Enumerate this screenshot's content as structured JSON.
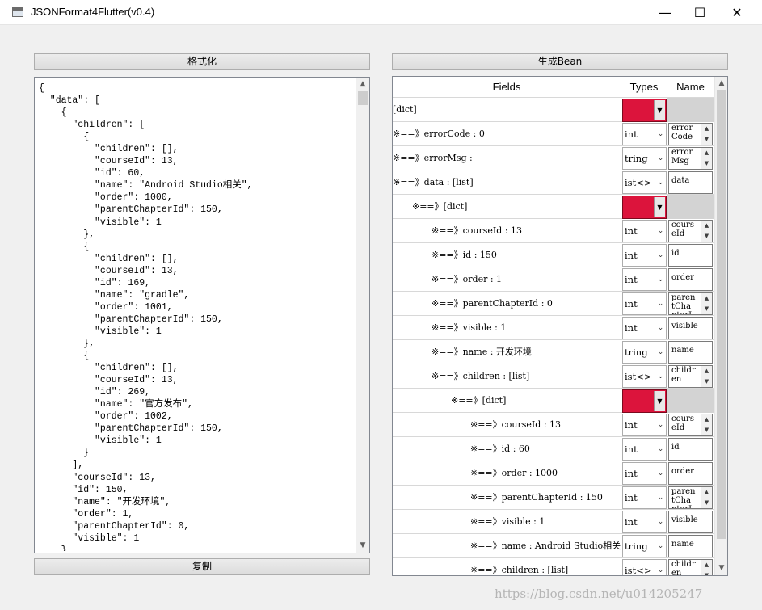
{
  "window": {
    "title": "JSONFormat4Flutter(v0.4)",
    "minimize_glyph": "—",
    "maximize_glyph": "☐",
    "close_glyph": "✕"
  },
  "left": {
    "format_button": "格式化",
    "copy_button": "复制",
    "json_text": "{\n  \"data\": [\n    {\n      \"children\": [\n        {\n          \"children\": [],\n          \"courseId\": 13,\n          \"id\": 60,\n          \"name\": \"Android Studio相关\",\n          \"order\": 1000,\n          \"parentChapterId\": 150,\n          \"visible\": 1\n        },\n        {\n          \"children\": [],\n          \"courseId\": 13,\n          \"id\": 169,\n          \"name\": \"gradle\",\n          \"order\": 1001,\n          \"parentChapterId\": 150,\n          \"visible\": 1\n        },\n        {\n          \"children\": [],\n          \"courseId\": 13,\n          \"id\": 269,\n          \"name\": \"官方发布\",\n          \"order\": 1002,\n          \"parentChapterId\": 150,\n          \"visible\": 1\n        }\n      ],\n      \"courseId\": 13,\n      \"id\": 150,\n      \"name\": \"开发环境\",\n      \"order\": 1,\n      \"parentChapterId\": 0,\n      \"visible\": 1\n    },"
  },
  "right": {
    "generate_button": "生成Bean",
    "headers": {
      "fields": "Fields",
      "types": "Types",
      "name": "Name"
    },
    "rows": [
      {
        "field": "[dict]",
        "type": "",
        "name": ""
      },
      {
        "field": "※==》errorCode : 0",
        "type": "int",
        "name": "errorCode"
      },
      {
        "field": "※==》errorMsg : ",
        "type": "tring",
        "name": "errorMsg"
      },
      {
        "field": "※==》data : [list]",
        "type": "ist<>",
        "name": "data"
      },
      {
        "field": "※==》[dict]",
        "type": "",
        "name": ""
      },
      {
        "field": "※==》courseId : 13",
        "type": "int",
        "name": "courseId"
      },
      {
        "field": "※==》id : 150",
        "type": "int",
        "name": "id"
      },
      {
        "field": "※==》order : 1",
        "type": "int",
        "name": "order"
      },
      {
        "field": "※==》parentChapterId : 0",
        "type": "int",
        "name": "parentChapterId"
      },
      {
        "field": "※==》visible : 1",
        "type": "int",
        "name": "visible"
      },
      {
        "field": "※==》name : 开发环境",
        "type": "tring",
        "name": "name"
      },
      {
        "field": "※==》children : [list]",
        "type": "ist<>",
        "name": "children"
      },
      {
        "field": "※==》[dict]",
        "type": "",
        "name": ""
      },
      {
        "field": "※==》courseId : 13",
        "type": "int",
        "name": "courseId"
      },
      {
        "field": "※==》id : 60",
        "type": "int",
        "name": "id"
      },
      {
        "field": "※==》order : 1000",
        "type": "int",
        "name": "order"
      },
      {
        "field": "※==》parentChapterId : 150",
        "type": "int",
        "name": "parentChapterId"
      },
      {
        "field": "※==》visible : 1",
        "type": "int",
        "name": "visible"
      },
      {
        "field": "※==》name : Android Studio相关",
        "type": "tring",
        "name": "name"
      },
      {
        "field": "※==》children : [list]",
        "type": "ist<>",
        "name": "children"
      }
    ],
    "dict_color": "#dc143c"
  },
  "watermark": "https://blog.csdn.net/u014205247"
}
